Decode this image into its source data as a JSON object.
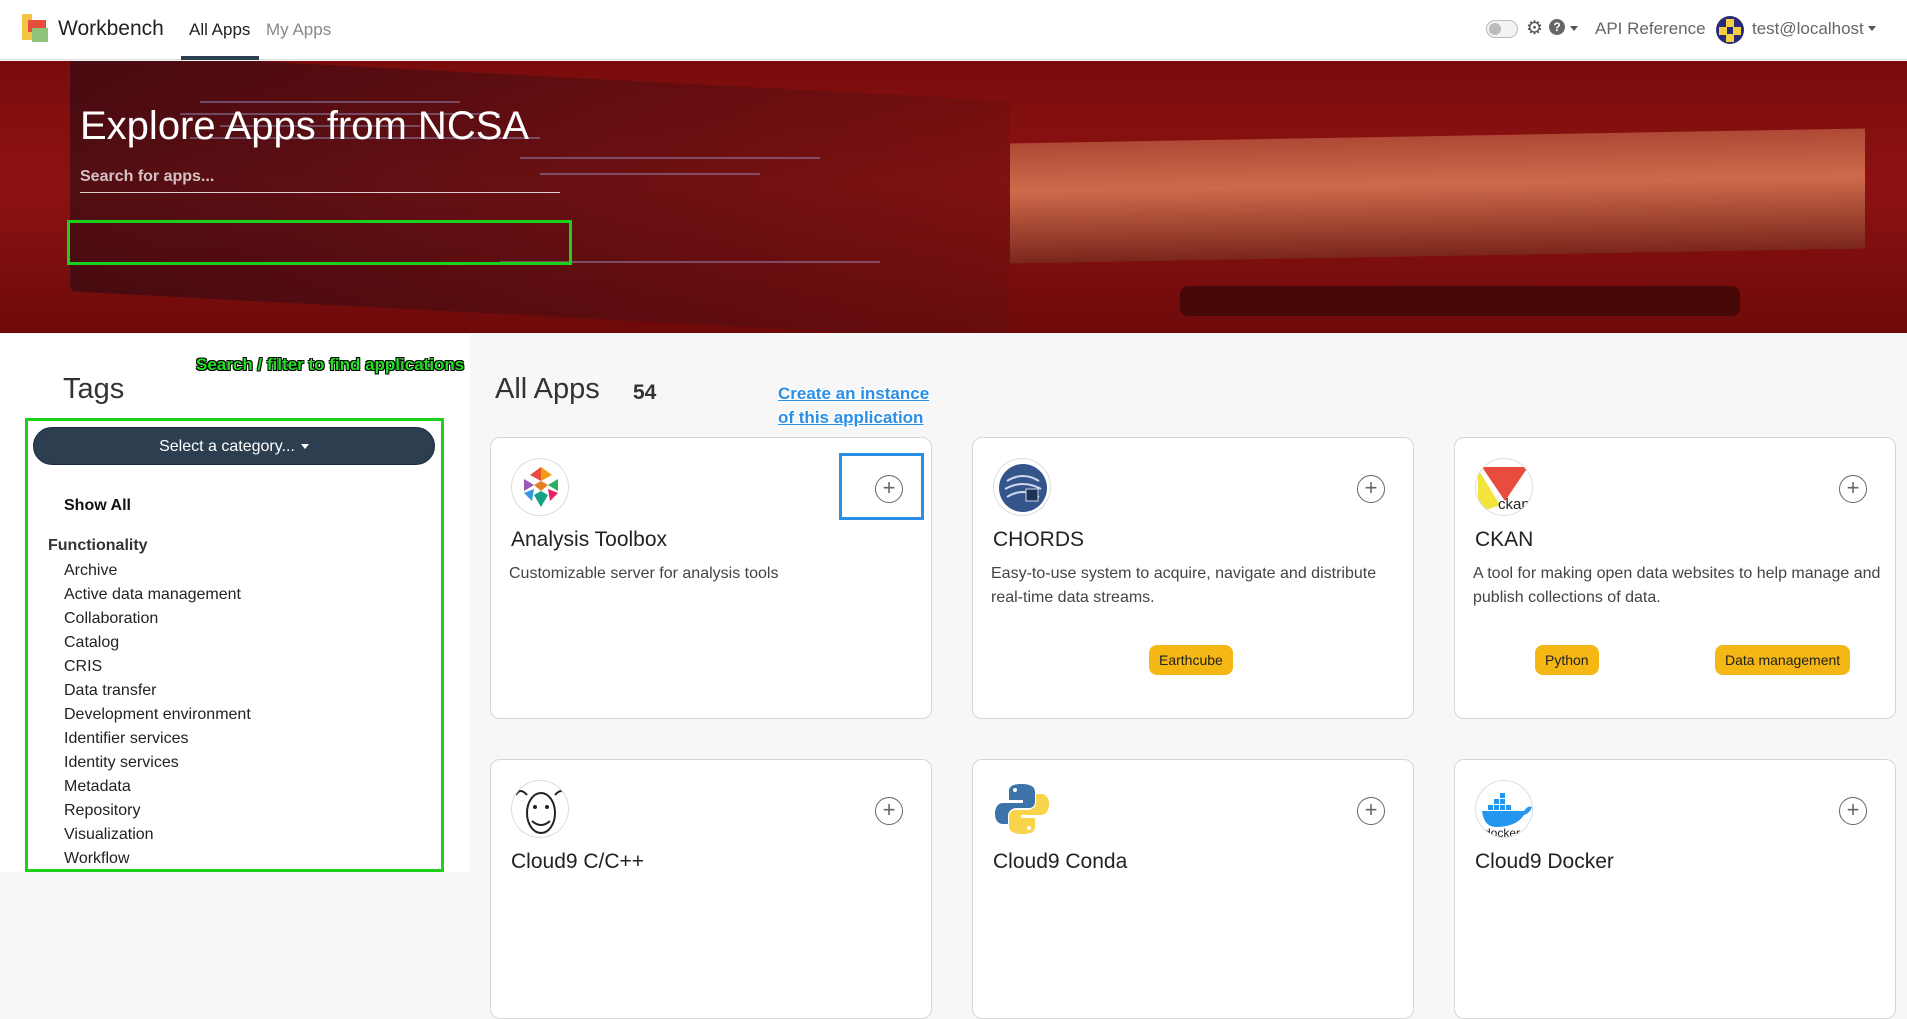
{
  "nav": {
    "brand": "Workbench",
    "tabs": [
      "All Apps",
      "My Apps"
    ],
    "api_reference": "API Reference",
    "user": "test@localhost",
    "help_glyph": "?"
  },
  "hero": {
    "title": "Explore Apps from NCSA",
    "search_placeholder": "Search for apps..."
  },
  "annotations": {
    "filter_note": "Search / filter to find applications",
    "create_note_line1": "Create an instance",
    "create_note_line2": "of this application"
  },
  "sidebar": {
    "title": "Tags",
    "category_select": "Select a category...",
    "show_all": "Show All",
    "group": "Functionality",
    "items": [
      "Archive",
      "Active data management",
      "Collaboration",
      "Catalog",
      "CRIS",
      "Data transfer",
      "Development environment",
      "Identifier services",
      "Identity services",
      "Metadata",
      "Repository",
      "Visualization",
      "Workflow"
    ]
  },
  "main": {
    "title": "All Apps",
    "count": "54",
    "add_glyph": "+",
    "cards": [
      {
        "name": "Analysis Toolbox",
        "description": "Customizable server for analysis tools",
        "tags": [],
        "icon": "analysis-toolbox-logo"
      },
      {
        "name": "CHORDS",
        "description": "Easy-to-use system to acquire, navigate and distribute real-time data streams.",
        "tags": [
          "Earthcube"
        ],
        "icon": "chords-logo"
      },
      {
        "name": "CKAN",
        "description": "A tool for making open data websites to help manage and publish collections of data.",
        "tags": [
          "Python",
          "Data management"
        ],
        "icon": "ckan-logo",
        "logo_text": "ckan"
      },
      {
        "name": "Cloud9 C/C++",
        "description": "",
        "tags": [],
        "icon": "gnu-logo"
      },
      {
        "name": "Cloud9 Conda",
        "description": "",
        "tags": [],
        "icon": "python-logo"
      },
      {
        "name": "Cloud9 Docker",
        "description": "",
        "tags": [],
        "icon": "docker-logo",
        "logo_text": "docker"
      }
    ]
  },
  "colors": {
    "accent_dark": "#2d3e50",
    "hero_red": "#8d1212",
    "badge_yellow": "#f5b714",
    "annotation_green": "#1bd11b",
    "annotation_blue": "#2b8fe8"
  }
}
